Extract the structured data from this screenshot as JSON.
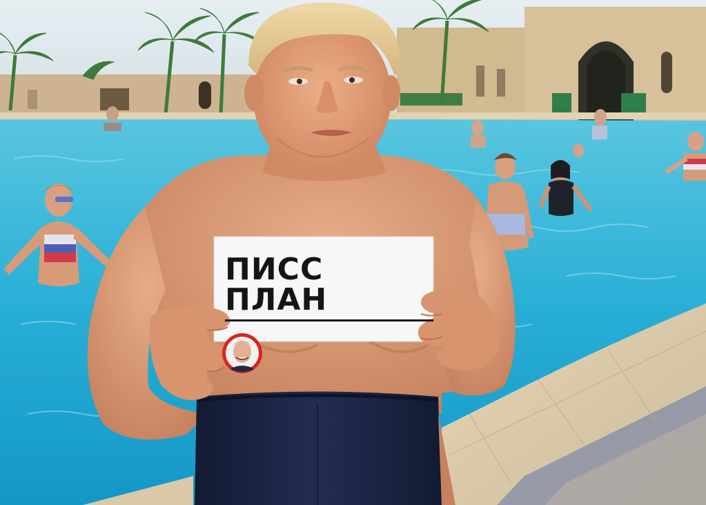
{
  "sign": {
    "text": "ПИСС ПЛАН"
  },
  "colors": {
    "sky": "#dfe9ee",
    "pool": "#2fb3d6",
    "pool_deep": "#138fbe",
    "building": "#cdb390",
    "skin": "#d99a74",
    "trunks": "#1b2340",
    "sign_bg": "#f7f7f7",
    "badge_red": "#d9261c"
  },
  "icons": [
    "badge-avatar-icon"
  ]
}
